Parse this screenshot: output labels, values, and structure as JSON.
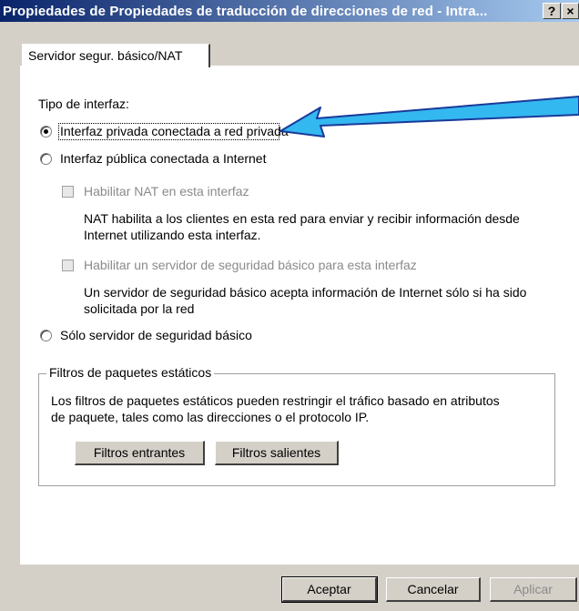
{
  "window": {
    "title": "Propiedades de Propiedades de traducción de direcciones de red - Intra...",
    "help_label": "?",
    "close_label": "×"
  },
  "tab": {
    "label": "Servidor segur. básico/NAT"
  },
  "interface_type": {
    "label": "Tipo de interfaz:",
    "option_private": "Interfaz privada conectada a red privada",
    "option_public": "Interfaz pública conectada a Internet",
    "option_firewall": "Sólo servidor de seguridad básico",
    "selected": "private"
  },
  "nat": {
    "checkbox_label": "Habilitar NAT en esta interfaz",
    "description_line1": "NAT habilita a los clientes en esta red para enviar y recibir información desde",
    "description_line2": "Internet utilizando esta interfaz."
  },
  "firewall": {
    "checkbox_label": "Habilitar un servidor de seguridad básico para esta interfaz",
    "description_line1": "Un servidor de seguridad básico acepta información de Internet sólo si ha sido",
    "description_line2": "solicitada por la red"
  },
  "static_filters": {
    "group_label": "Filtros de paquetes estáticos",
    "description_line1": "Los filtros de paquetes estáticos pueden restringir el tráfico basado en atributos",
    "description_line2": "de paquete, tales como las direcciones o el protocolo IP.",
    "inbound_button": "Filtros entrantes",
    "outbound_button": "Filtros salientes"
  },
  "buttons": {
    "ok": "Aceptar",
    "cancel": "Cancelar",
    "apply": "Aplicar"
  },
  "colors": {
    "title_gradient_start": "#0a246a",
    "title_gradient_end": "#a6caf0",
    "arrow_fill": "#33b8f0",
    "arrow_stroke": "#1a3a9a"
  }
}
